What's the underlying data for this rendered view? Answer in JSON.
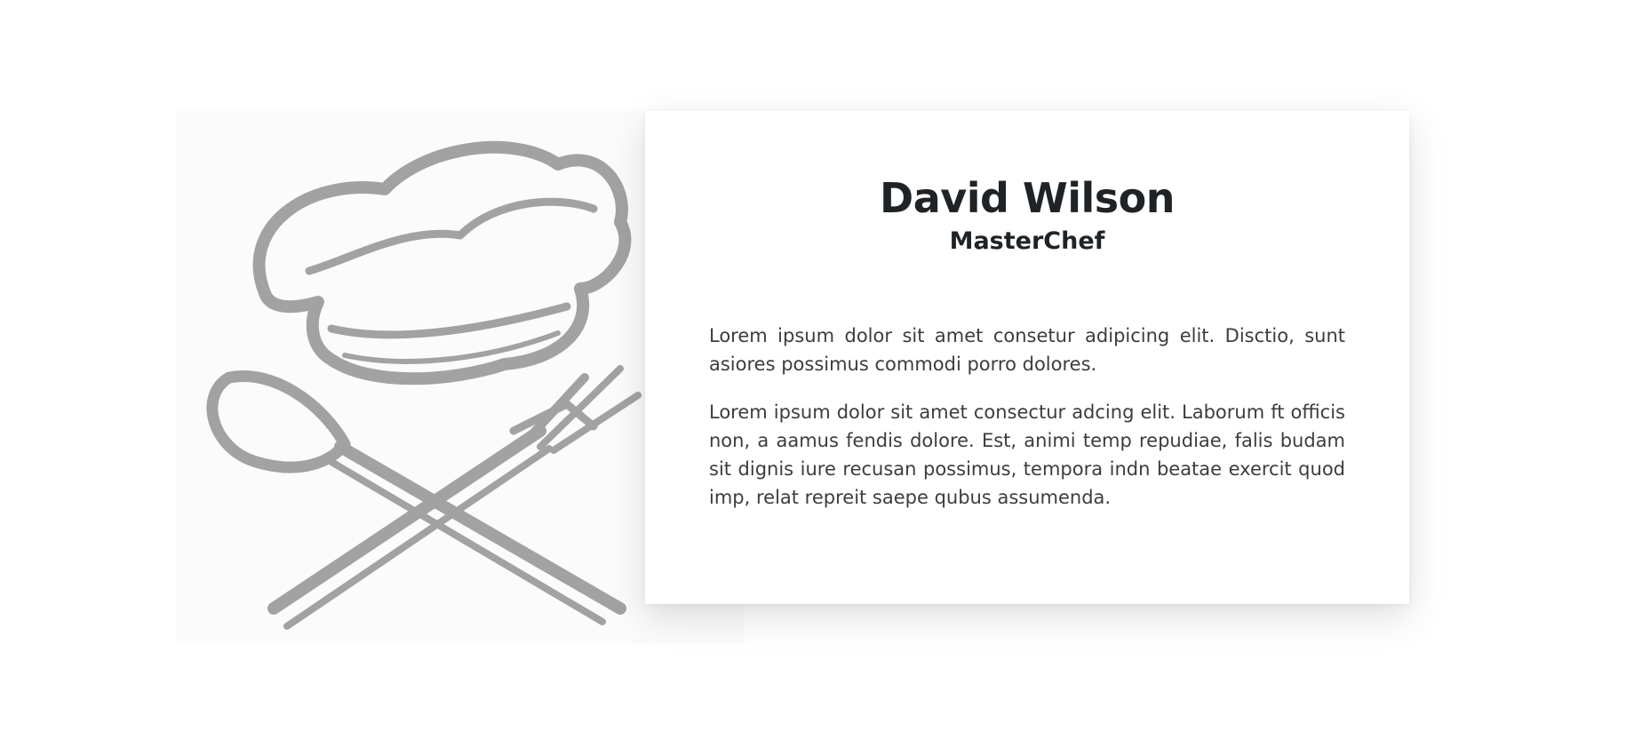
{
  "profile": {
    "name": "David Wilson",
    "title": "MasterChef",
    "bio": [
      "Lorem ipsum dolor sit amet consetur adipicing elit. Disctio, sunt asiores possimus commodi porro dolores.",
      "Lorem ipsum dolor sit amet consectur adcing elit. Laborum ft officis non, a aamus fendis dolore. Est, animi temp repudiae, falis budam sit dignis iure recusan possimus, tempora indn beatae exercit quod imp, relat repreit saepe qubus assumenda."
    ]
  },
  "image": {
    "icon": "chef-hat-spoon-fork-icon",
    "stroke_color": "#a2a2a2"
  },
  "colors": {
    "heading": "#1f2326",
    "body_text": "#3a3d40",
    "card_background": "#ffffff"
  }
}
